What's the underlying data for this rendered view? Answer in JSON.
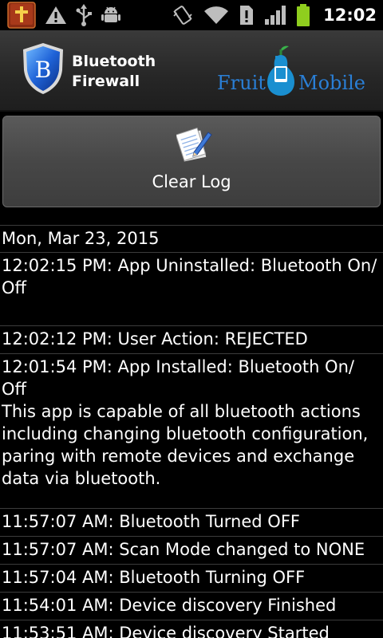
{
  "status_bar": {
    "time": "12:02",
    "left_icons": [
      "bible-app-icon",
      "warning-icon",
      "usb-icon",
      "android-debug-icon"
    ],
    "right_icons": [
      "vibrate-icon",
      "wifi-icon",
      "sim-alert-icon",
      "signal-icon",
      "battery-icon"
    ],
    "battery_color": "#8fce1e"
  },
  "header": {
    "title_line1": "Bluetooth",
    "title_line2": "Firewall",
    "shield_letter": "B",
    "brand_left": "Fruit",
    "brand_right": "Mobile",
    "brand_color": "#2a7fd6"
  },
  "clear_button": {
    "label": "Clear Log"
  },
  "log": {
    "date": "Mon, Mar 23, 2015",
    "entries": [
      {
        "text": "12:02:15 PM: App Uninstalled: Bluetooth On/ Off"
      },
      {
        "text": "12:02:12 PM: User Action: REJECTED"
      },
      {
        "text": "12:01:54 PM: App Installed: Bluetooth On/ Off",
        "description": "This app is capable of all bluetooth actions including changing bluetooth configuration, paring with remote devices and exchange data via bluetooth."
      },
      {
        "text": "11:57:07 AM: Bluetooth Turned OFF"
      },
      {
        "text": "11:57:07 AM: Scan Mode changed to NONE"
      },
      {
        "text": "11:57:04 AM: Bluetooth Turning OFF"
      },
      {
        "text": "11:54:01 AM: Device discovery Finished"
      },
      {
        "text": "11:53:51 AM: Device discovery Started"
      }
    ]
  }
}
